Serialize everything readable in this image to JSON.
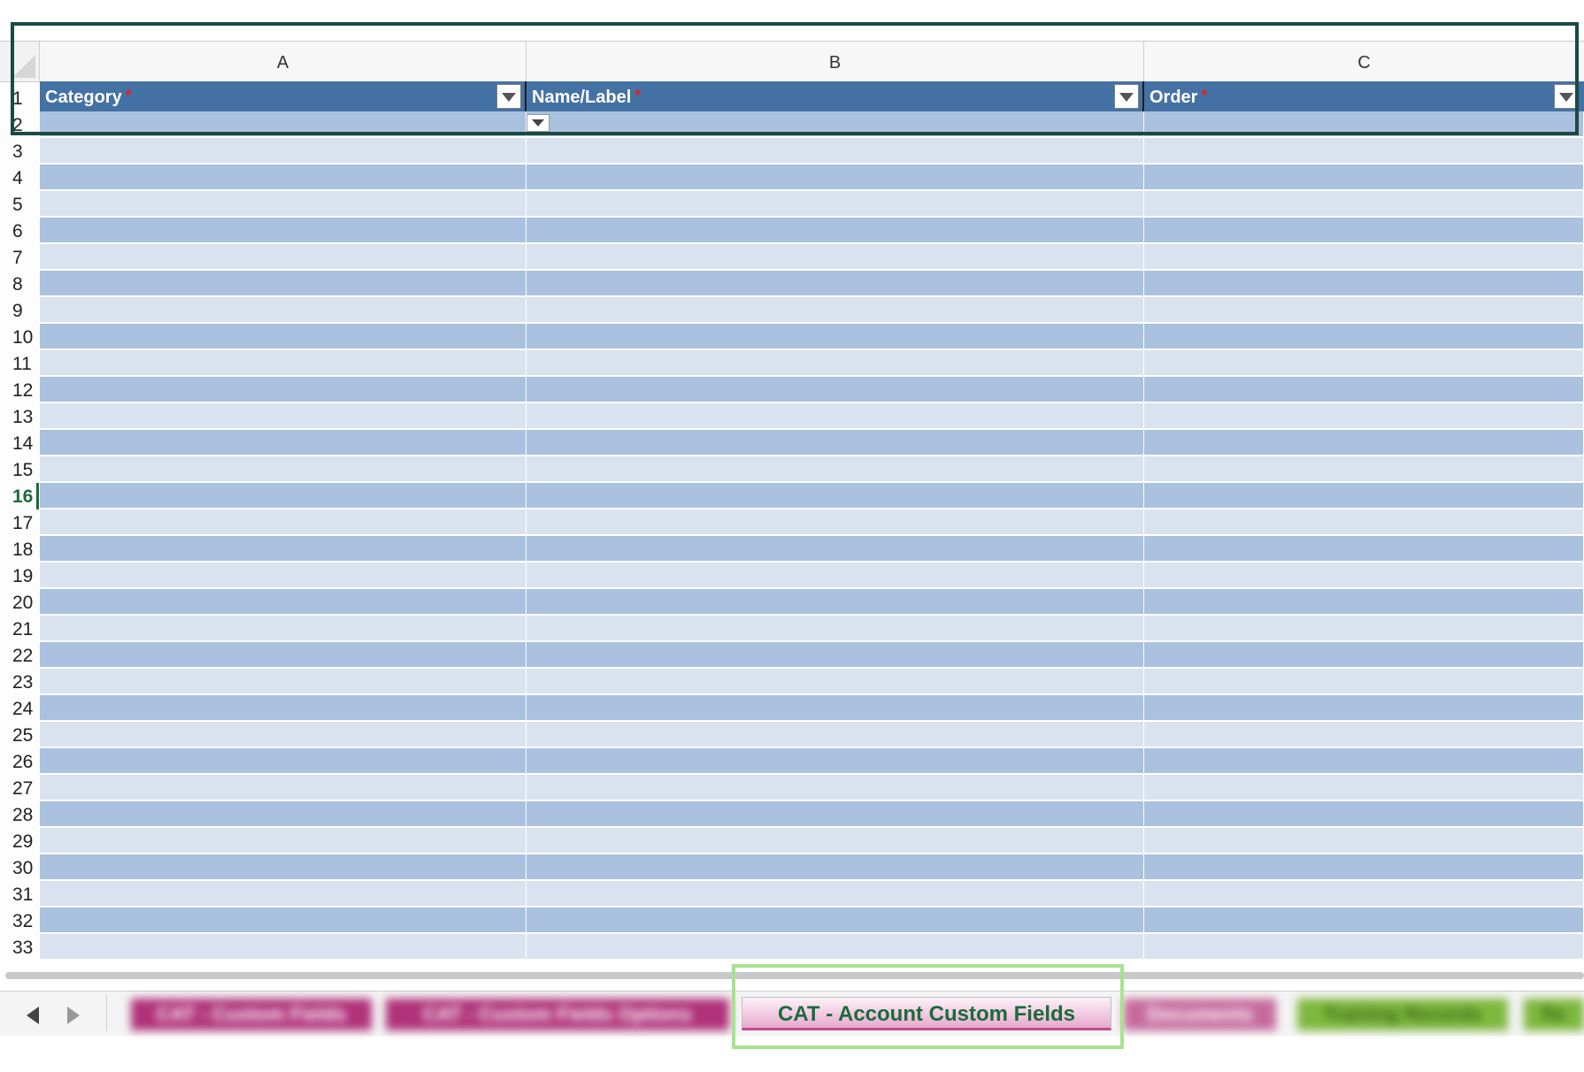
{
  "columns": [
    {
      "letter": "A",
      "header": "Category",
      "required_mark": "*"
    },
    {
      "letter": "B",
      "header": "Name/Label",
      "required_mark": "*"
    },
    {
      "letter": "C",
      "header": "Order",
      "required_mark": "*"
    }
  ],
  "rows": [
    "1",
    "2",
    "3",
    "4",
    "5",
    "6",
    "7",
    "8",
    "9",
    "10",
    "11",
    "12",
    "13",
    "14",
    "15",
    "16",
    "17",
    "18",
    "19",
    "20",
    "21",
    "22",
    "23",
    "24",
    "25",
    "26",
    "27",
    "28",
    "29",
    "30",
    "31",
    "32",
    "33"
  ],
  "active_row": "16",
  "sheet_tabs": {
    "active": "CAT - Account Custom Fields",
    "others": [
      {
        "label": "CAT - Custom Fields",
        "color": "#b0327a"
      },
      {
        "label": "CAT - Custom Fields Options",
        "color": "#b0327a"
      },
      {
        "label": "Documents",
        "color": "#c66a9d"
      },
      {
        "label": "Training Records",
        "color": "#7fb83e"
      },
      {
        "label": "Re",
        "color": "#7fb83e"
      }
    ]
  },
  "colors": {
    "header_bg": "#4472a4",
    "band_light": "#d9e3f0",
    "band_dark": "#aac1df",
    "required_star": "#e0202a",
    "active_row_text": "#1a6b3c",
    "highlight_box": "#1b4a42",
    "active_tab_highlight": "#a8e28f"
  },
  "icons": {
    "filter": "chevron-down-icon",
    "prev": "triangle-left-icon",
    "next": "triangle-right-icon"
  }
}
